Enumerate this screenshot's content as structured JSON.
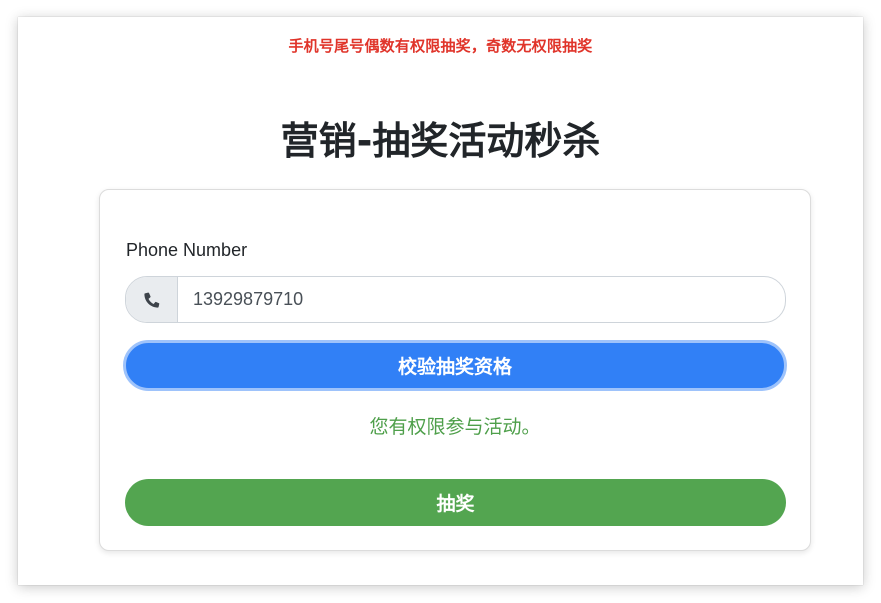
{
  "notice": {
    "text": "手机号尾号偶数有权限抽奖，奇数无权限抽奖",
    "color": "#e0342a"
  },
  "page": {
    "title": "营销-抽奖活动秒杀"
  },
  "form": {
    "phone_label": "Phone Number",
    "phone_value": "13929879710",
    "phone_icon": "phone-icon",
    "verify_button": "校验抽奖资格",
    "result_text": "您有权限参与活动。",
    "draw_button": "抽奖"
  },
  "colors": {
    "primary": "#3180f6",
    "success": "#53a550",
    "result_text": "#4e9f4a"
  }
}
